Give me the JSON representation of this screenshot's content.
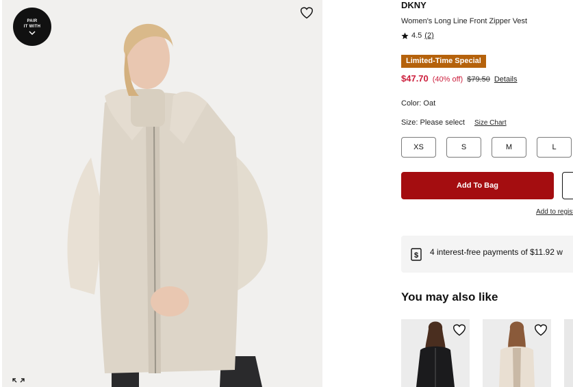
{
  "media": {
    "pair_line1": "PAIR",
    "pair_line2": "IT WITH"
  },
  "product": {
    "brand": "DKNY",
    "name": "Women's Long Line Front Zipper Vest",
    "rating": "4.5",
    "review_count": "(2)",
    "promo_badge": "Limited-Time Special",
    "sale_price": "$47.70",
    "discount": "(40% off)",
    "original_price": "$79.50",
    "details_link": "Details",
    "color_label": "Color: Oat",
    "size_label": "Size: Please select",
    "size_chart_link": "Size Chart",
    "sizes": [
      "XS",
      "S",
      "M",
      "L"
    ],
    "add_to_bag": "Add To Bag",
    "registry_link": "Add to regist",
    "payments_text": "4 interest-free payments of $11.92 w"
  },
  "recommendations": {
    "heading": "You may also like"
  },
  "colors": {
    "accent_red": "#a40d10",
    "sale_red": "#cc1e3c",
    "promo_orange": "#b5620c"
  },
  "icons": [
    "heart-icon",
    "expand-icon",
    "star-icon",
    "dollar-icon",
    "chevron-down-icon"
  ]
}
